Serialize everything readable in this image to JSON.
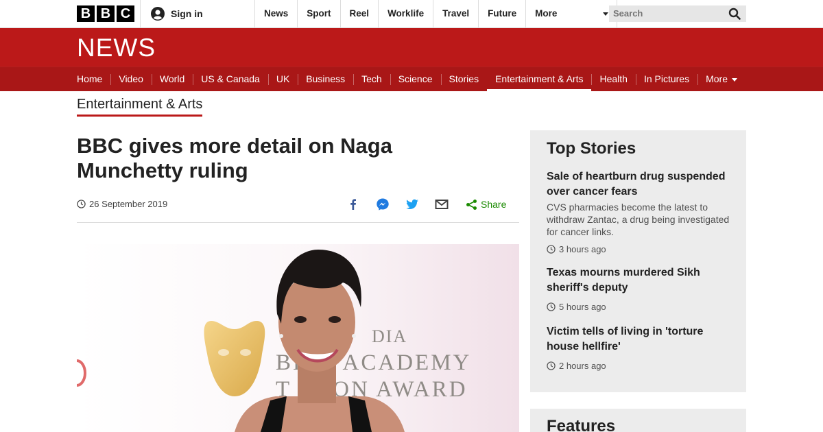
{
  "brand": {
    "logo_letters": [
      "B",
      "B",
      "C"
    ],
    "news_wordmark": "NEWS",
    "colors": {
      "red": "#bb1919",
      "red_dark": "#a91717",
      "share_green": "#1a8a00"
    }
  },
  "topbar": {
    "signin_label": "Sign in",
    "nav": [
      "News",
      "Sport",
      "Reel",
      "Worklife",
      "Travel",
      "Future",
      "More"
    ],
    "search_placeholder": "Search"
  },
  "section_nav": {
    "items": [
      "Home",
      "Video",
      "World",
      "US & Canada",
      "UK",
      "Business",
      "Tech",
      "Science",
      "Stories",
      "Entertainment & Arts",
      "Health",
      "In Pictures",
      "More"
    ],
    "active": "Entertainment & Arts"
  },
  "article": {
    "section": "Entertainment & Arts",
    "headline": "BBC gives more detail on Naga Munchetty ruling",
    "date": "26 September 2019",
    "share_label": "Share",
    "share_icons": [
      "facebook-icon",
      "messenger-icon",
      "twitter-icon",
      "email-icon",
      "share-icon"
    ],
    "image_text": {
      "line1": "DIA",
      "line2": "BR    H ACADEMY",
      "line3": "T    ISION AWARD"
    }
  },
  "top_stories": {
    "heading": "Top Stories",
    "items": [
      {
        "title": "Sale of heartburn drug suspended over cancer fears",
        "summary": "CVS pharmacies become the latest to withdraw Zantac, a drug being investigated for cancer links.",
        "time": "3 hours ago"
      },
      {
        "title": "Texas mourns murdered Sikh sheriff's deputy",
        "summary": "",
        "time": "5 hours ago"
      },
      {
        "title": "Victim tells of living in 'torture house hellfire'",
        "summary": "",
        "time": "2 hours ago"
      }
    ]
  },
  "features": {
    "heading": "Features"
  }
}
